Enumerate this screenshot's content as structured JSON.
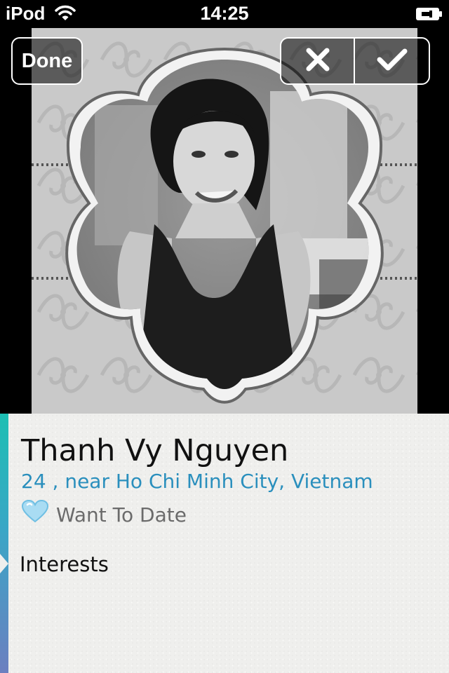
{
  "status_bar": {
    "carrier": "iPod",
    "time": "14:25",
    "icons": [
      "wifi-icon",
      "battery-icon"
    ]
  },
  "toolbar": {
    "done_label": "Done",
    "reject_icon": "close-icon",
    "accept_icon": "checkmark-icon"
  },
  "profile": {
    "name": "Thanh Vy Nguyen",
    "location": "24 , near Ho Chi Minh City, Vietnam",
    "status_icon": "heart-icon",
    "status_label": "Want To Date",
    "interests_heading": "Interests"
  },
  "colors": {
    "accent_teal": "#1dbfb3",
    "accent_purple": "#6c7fc0",
    "location_blue": "#2a8fbd",
    "heart_blue": "#a9dcf3"
  }
}
